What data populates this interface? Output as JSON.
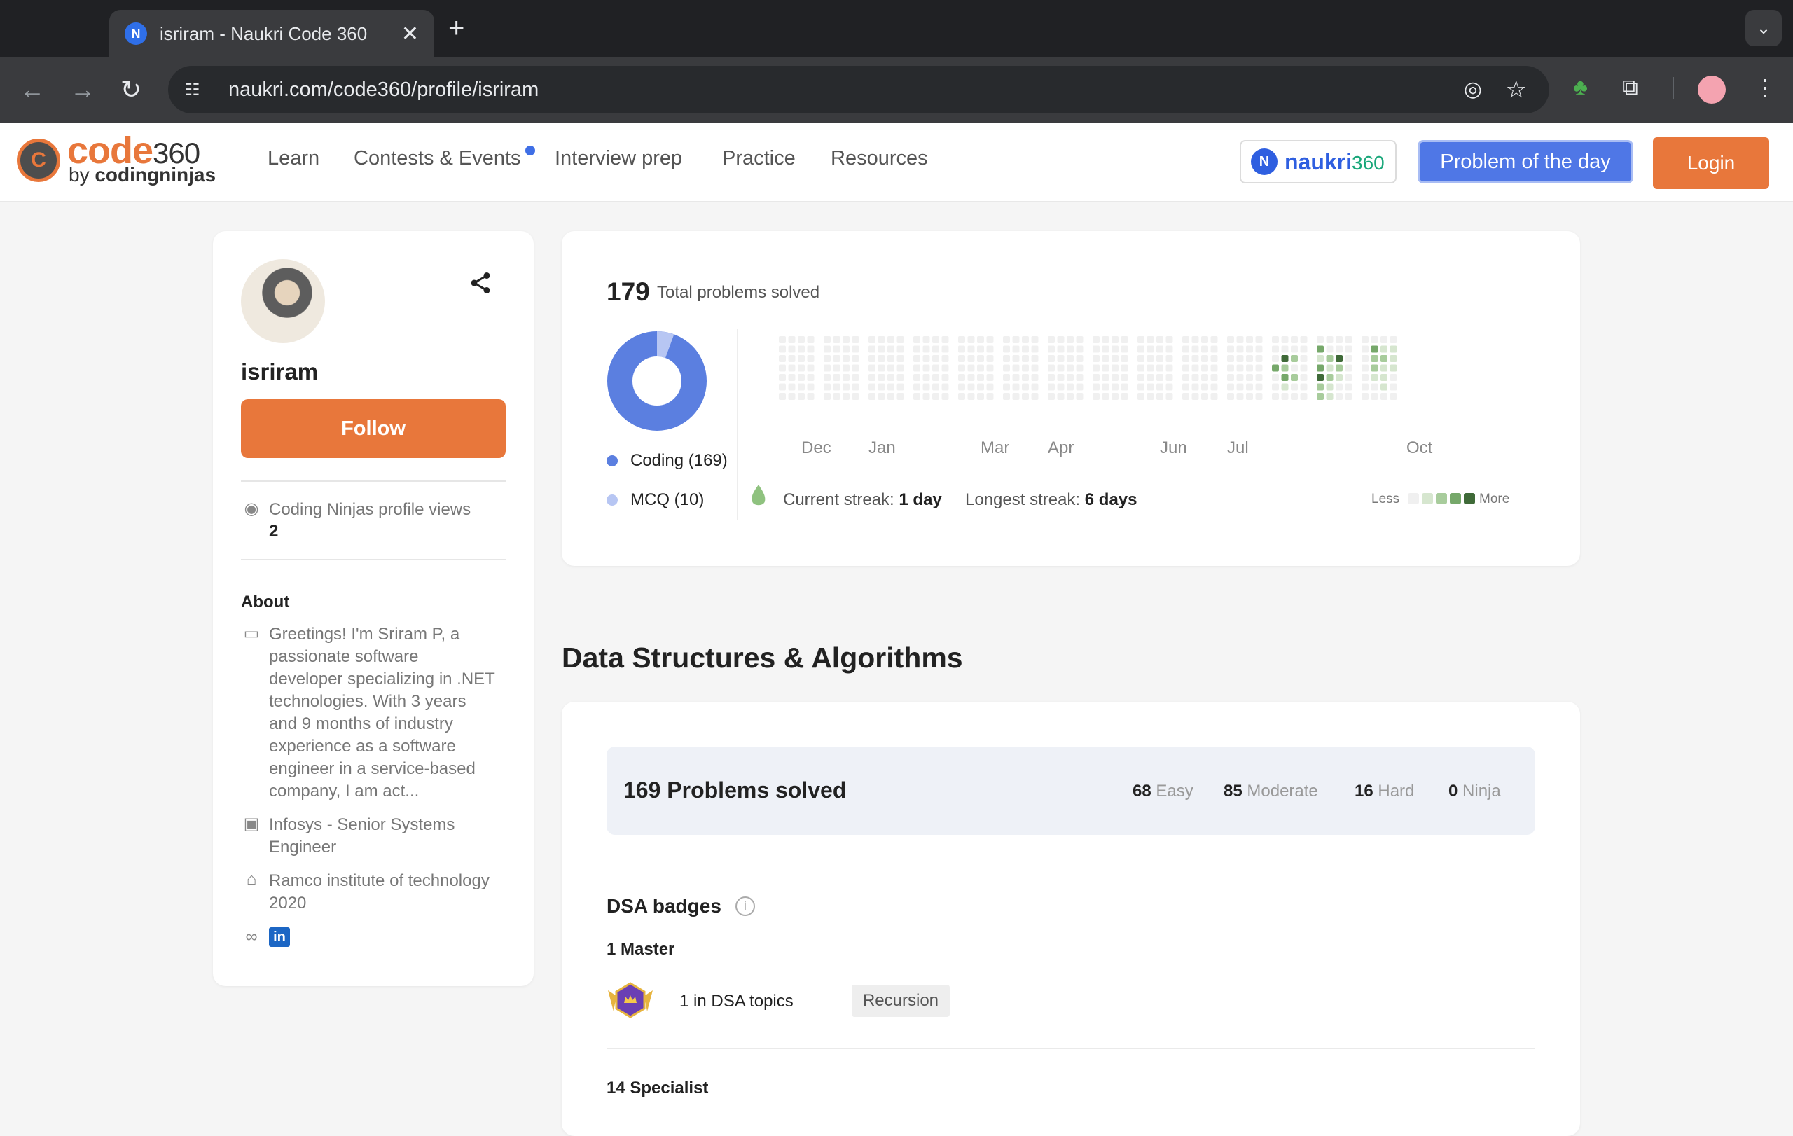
{
  "browser": {
    "tab_title": "isriram - Naukri Code 360",
    "url": "naukri.com/code360/profile/isriram"
  },
  "site": {
    "logo_main": "code",
    "logo_num": "360",
    "logo_by": "by",
    "logo_brand": "codingninjas",
    "nav": [
      "Learn",
      "Contests & Events",
      "Interview prep",
      "Practice",
      "Resources"
    ],
    "naukri_label": "naukri",
    "naukri_num": "360",
    "potd_label": "Problem of the day",
    "login_label": "Login"
  },
  "profile": {
    "username": "isriram",
    "follow_label": "Follow",
    "views_label": "Coding Ninjas profile views",
    "views_value": "2",
    "about_heading": "About",
    "about_lines": [
      "Greetings! I'm Sriram P, a",
      "passionate software",
      "developer specializing in .NET",
      "technologies. With 3 years",
      "and 9 months of industry",
      "experience as a software",
      "engineer in a service-based",
      "company, I am act..."
    ],
    "work_lines": [
      "Infosys - Senior Systems",
      "Engineer"
    ],
    "edu_lines": [
      "Ramco institute of technology",
      "2020"
    ],
    "linkedin_label": "in"
  },
  "stats": {
    "total": "179",
    "total_label": "Total problems solved",
    "legend": [
      {
        "label": "Coding (169)",
        "color": "#5b7fe0"
      },
      {
        "label": "MCQ (10)",
        "color": "#b7c6f3"
      }
    ],
    "months": [
      "Dec",
      "Jan",
      "Mar",
      "Apr",
      "Jun",
      "Jul",
      "Oct"
    ],
    "current_streak_label": "Current streak:",
    "current_streak_value": "1 day",
    "longest_streak_label": "Longest streak:",
    "longest_streak_value": "6 days",
    "less_label": "Less",
    "more_label": "More",
    "heat_colors": [
      "#f0f0f0",
      "#d6e6cf",
      "#a8cc9c",
      "#76a86a",
      "#3f6a38"
    ]
  },
  "dsa": {
    "heading": "Data Structures & Algorithms",
    "problems_solved": "169 Problems solved",
    "difficulty": [
      {
        "count": "68",
        "label": "Easy"
      },
      {
        "count": "85",
        "label": "Moderate"
      },
      {
        "count": "16",
        "label": "Hard"
      },
      {
        "count": "0",
        "label": "Ninja"
      }
    ],
    "badges_heading": "DSA badges",
    "master_heading": "1 Master",
    "badge_text": "1 in DSA topics",
    "badge_tag": "Recursion",
    "specialist_heading": "14 Specialist"
  }
}
